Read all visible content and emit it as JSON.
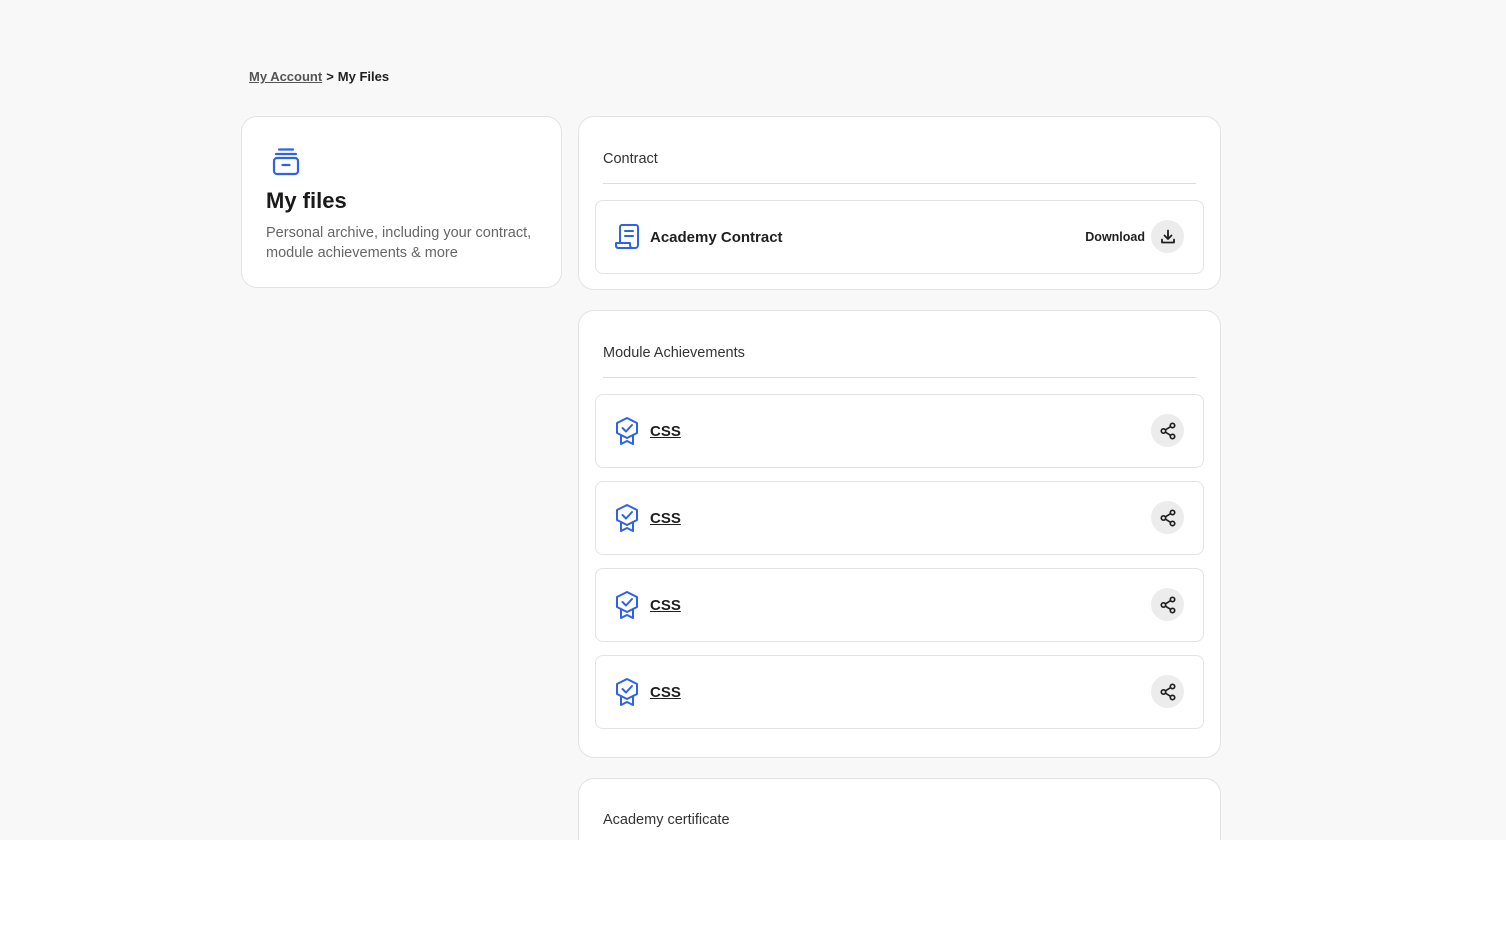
{
  "breadcrumb": {
    "parent": "My Account",
    "separator": ">",
    "current": "My Files"
  },
  "intro": {
    "icon": "archive-icon",
    "title": "My files",
    "description": "Personal archive, including your contract, module achievements & more"
  },
  "contract": {
    "section_title": "Contract",
    "item": {
      "icon": "document-scroll-icon",
      "label": "Academy Contract",
      "action_label": "Download",
      "action_icon": "download-icon"
    }
  },
  "achievements": {
    "section_title": "Module Achievements",
    "items": [
      {
        "icon": "badge-check-icon",
        "label": "CSS",
        "action_icon": "share-icon"
      },
      {
        "icon": "badge-check-icon",
        "label": "CSS",
        "action_icon": "share-icon"
      },
      {
        "icon": "badge-check-icon",
        "label": "CSS",
        "action_icon": "share-icon"
      },
      {
        "icon": "badge-check-icon",
        "label": "CSS",
        "action_icon": "share-icon"
      }
    ]
  },
  "certificate": {
    "section_title": "Academy certificate"
  },
  "colors": {
    "accent": "#2f62e6",
    "page_background": "#f8f8f8",
    "card_background": "#ffffff",
    "border": "#e3e3e3",
    "icon_button_background": "#ececec"
  }
}
